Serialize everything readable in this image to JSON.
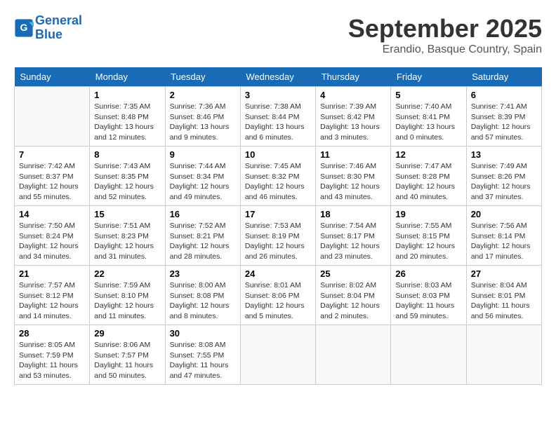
{
  "header": {
    "logo_line1": "General",
    "logo_line2": "Blue",
    "month": "September 2025",
    "location": "Erandio, Basque Country, Spain"
  },
  "weekdays": [
    "Sunday",
    "Monday",
    "Tuesday",
    "Wednesday",
    "Thursday",
    "Friday",
    "Saturday"
  ],
  "weeks": [
    [
      {
        "day": "",
        "text": ""
      },
      {
        "day": "1",
        "text": "Sunrise: 7:35 AM\nSunset: 8:48 PM\nDaylight: 13 hours\nand 12 minutes."
      },
      {
        "day": "2",
        "text": "Sunrise: 7:36 AM\nSunset: 8:46 PM\nDaylight: 13 hours\nand 9 minutes."
      },
      {
        "day": "3",
        "text": "Sunrise: 7:38 AM\nSunset: 8:44 PM\nDaylight: 13 hours\nand 6 minutes."
      },
      {
        "day": "4",
        "text": "Sunrise: 7:39 AM\nSunset: 8:42 PM\nDaylight: 13 hours\nand 3 minutes."
      },
      {
        "day": "5",
        "text": "Sunrise: 7:40 AM\nSunset: 8:41 PM\nDaylight: 13 hours\nand 0 minutes."
      },
      {
        "day": "6",
        "text": "Sunrise: 7:41 AM\nSunset: 8:39 PM\nDaylight: 12 hours\nand 57 minutes."
      }
    ],
    [
      {
        "day": "7",
        "text": "Sunrise: 7:42 AM\nSunset: 8:37 PM\nDaylight: 12 hours\nand 55 minutes."
      },
      {
        "day": "8",
        "text": "Sunrise: 7:43 AM\nSunset: 8:35 PM\nDaylight: 12 hours\nand 52 minutes."
      },
      {
        "day": "9",
        "text": "Sunrise: 7:44 AM\nSunset: 8:34 PM\nDaylight: 12 hours\nand 49 minutes."
      },
      {
        "day": "10",
        "text": "Sunrise: 7:45 AM\nSunset: 8:32 PM\nDaylight: 12 hours\nand 46 minutes."
      },
      {
        "day": "11",
        "text": "Sunrise: 7:46 AM\nSunset: 8:30 PM\nDaylight: 12 hours\nand 43 minutes."
      },
      {
        "day": "12",
        "text": "Sunrise: 7:47 AM\nSunset: 8:28 PM\nDaylight: 12 hours\nand 40 minutes."
      },
      {
        "day": "13",
        "text": "Sunrise: 7:49 AM\nSunset: 8:26 PM\nDaylight: 12 hours\nand 37 minutes."
      }
    ],
    [
      {
        "day": "14",
        "text": "Sunrise: 7:50 AM\nSunset: 8:24 PM\nDaylight: 12 hours\nand 34 minutes."
      },
      {
        "day": "15",
        "text": "Sunrise: 7:51 AM\nSunset: 8:23 PM\nDaylight: 12 hours\nand 31 minutes."
      },
      {
        "day": "16",
        "text": "Sunrise: 7:52 AM\nSunset: 8:21 PM\nDaylight: 12 hours\nand 28 minutes."
      },
      {
        "day": "17",
        "text": "Sunrise: 7:53 AM\nSunset: 8:19 PM\nDaylight: 12 hours\nand 26 minutes."
      },
      {
        "day": "18",
        "text": "Sunrise: 7:54 AM\nSunset: 8:17 PM\nDaylight: 12 hours\nand 23 minutes."
      },
      {
        "day": "19",
        "text": "Sunrise: 7:55 AM\nSunset: 8:15 PM\nDaylight: 12 hours\nand 20 minutes."
      },
      {
        "day": "20",
        "text": "Sunrise: 7:56 AM\nSunset: 8:14 PM\nDaylight: 12 hours\nand 17 minutes."
      }
    ],
    [
      {
        "day": "21",
        "text": "Sunrise: 7:57 AM\nSunset: 8:12 PM\nDaylight: 12 hours\nand 14 minutes."
      },
      {
        "day": "22",
        "text": "Sunrise: 7:59 AM\nSunset: 8:10 PM\nDaylight: 12 hours\nand 11 minutes."
      },
      {
        "day": "23",
        "text": "Sunrise: 8:00 AM\nSunset: 8:08 PM\nDaylight: 12 hours\nand 8 minutes."
      },
      {
        "day": "24",
        "text": "Sunrise: 8:01 AM\nSunset: 8:06 PM\nDaylight: 12 hours\nand 5 minutes."
      },
      {
        "day": "25",
        "text": "Sunrise: 8:02 AM\nSunset: 8:04 PM\nDaylight: 12 hours\nand 2 minutes."
      },
      {
        "day": "26",
        "text": "Sunrise: 8:03 AM\nSunset: 8:03 PM\nDaylight: 11 hours\nand 59 minutes."
      },
      {
        "day": "27",
        "text": "Sunrise: 8:04 AM\nSunset: 8:01 PM\nDaylight: 11 hours\nand 56 minutes."
      }
    ],
    [
      {
        "day": "28",
        "text": "Sunrise: 8:05 AM\nSunset: 7:59 PM\nDaylight: 11 hours\nand 53 minutes."
      },
      {
        "day": "29",
        "text": "Sunrise: 8:06 AM\nSunset: 7:57 PM\nDaylight: 11 hours\nand 50 minutes."
      },
      {
        "day": "30",
        "text": "Sunrise: 8:08 AM\nSunset: 7:55 PM\nDaylight: 11 hours\nand 47 minutes."
      },
      {
        "day": "",
        "text": ""
      },
      {
        "day": "",
        "text": ""
      },
      {
        "day": "",
        "text": ""
      },
      {
        "day": "",
        "text": ""
      }
    ]
  ]
}
